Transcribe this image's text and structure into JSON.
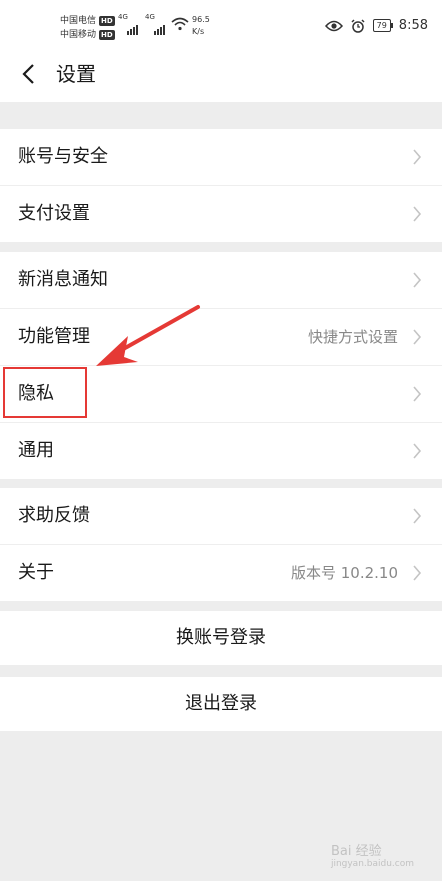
{
  "status_bar": {
    "carrier1": "中国电信",
    "carrier2": "中国移动",
    "hd": "HD",
    "net1": "4G",
    "net2": "4G",
    "speed_value": "96.5",
    "speed_unit": "K/s",
    "battery": "79",
    "time": "8:58",
    "icons": [
      "eye-icon",
      "alarm-icon",
      "wifi-icon",
      "signal-icon",
      "battery-icon"
    ]
  },
  "header": {
    "title": "设置",
    "back_icon": "chevron-left-icon"
  },
  "groups": [
    {
      "items": [
        {
          "label": "账号与安全"
        },
        {
          "label": "支付设置"
        }
      ]
    },
    {
      "items": [
        {
          "label": "新消息通知"
        },
        {
          "label": "功能管理",
          "value": "快捷方式设置"
        },
        {
          "label": "隐私"
        },
        {
          "label": "通用"
        }
      ]
    },
    {
      "items": [
        {
          "label": "求助反馈"
        },
        {
          "label": "关于",
          "value": "版本号 10.2.10"
        }
      ]
    }
  ],
  "buttons": {
    "switch_account": "换账号登录",
    "logout": "退出登录"
  },
  "annotation": {
    "color": "#e53935",
    "target": "隐私"
  },
  "watermark": {
    "text": "Bai 经验",
    "sub": "jingyan.baidu.com"
  }
}
